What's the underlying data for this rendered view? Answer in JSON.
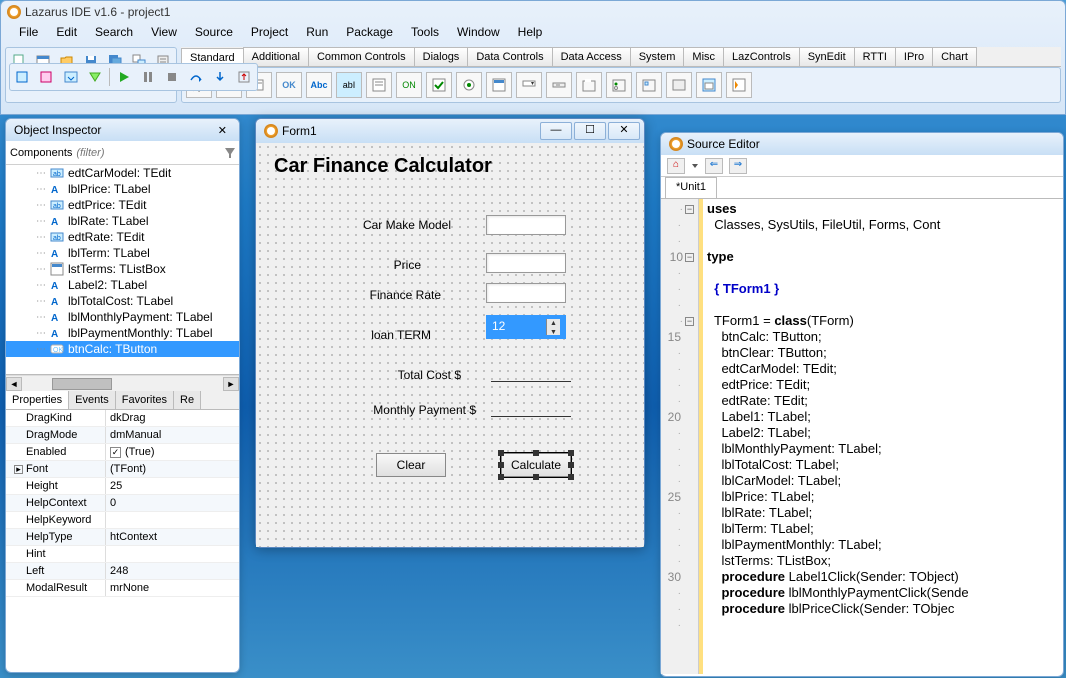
{
  "ide": {
    "title": "Lazarus IDE v1.6 - project1",
    "menu": [
      "File",
      "Edit",
      "Search",
      "View",
      "Source",
      "Project",
      "Run",
      "Package",
      "Tools",
      "Window",
      "Help"
    ],
    "component_tabs": [
      "Standard",
      "Additional",
      "Common Controls",
      "Dialogs",
      "Data Controls",
      "Data Access",
      "System",
      "Misc",
      "LazControls",
      "SynEdit",
      "RTTI",
      "IPro",
      "Chart"
    ],
    "active_comp_tab": "Standard"
  },
  "inspector": {
    "title": "Object Inspector",
    "filter_label": "Components",
    "filter_placeholder": "(filter)",
    "tree": [
      {
        "label": "edtCarModel: TEdit",
        "icon": "edit"
      },
      {
        "label": "lblPrice: TLabel",
        "icon": "label"
      },
      {
        "label": "edtPrice: TEdit",
        "icon": "edit"
      },
      {
        "label": "lblRate: TLabel",
        "icon": "label"
      },
      {
        "label": "edtRate: TEdit",
        "icon": "edit"
      },
      {
        "label": "lblTerm: TLabel",
        "icon": "label"
      },
      {
        "label": "lstTerms: TListBox",
        "icon": "list"
      },
      {
        "label": "Label2: TLabel",
        "icon": "label"
      },
      {
        "label": "lblTotalCost: TLabel",
        "icon": "label"
      },
      {
        "label": "lblMonthlyPayment: TLabel",
        "icon": "label"
      },
      {
        "label": "lblPaymentMonthly: TLabel",
        "icon": "label"
      },
      {
        "label": "btnCalc: TButton",
        "icon": "button",
        "selected": true
      }
    ],
    "prop_tabs": [
      "Properties",
      "Events",
      "Favorites",
      "Re"
    ],
    "active_prop_tab": "Properties",
    "props": [
      {
        "name": "DragKind",
        "value": "dkDrag"
      },
      {
        "name": "DragMode",
        "value": "dmManual"
      },
      {
        "name": "Enabled",
        "value": "(True)",
        "check": true
      },
      {
        "name": "Font",
        "value": "(TFont)",
        "expand": true
      },
      {
        "name": "Height",
        "value": "25"
      },
      {
        "name": "HelpContext",
        "value": "0"
      },
      {
        "name": "HelpKeyword",
        "value": ""
      },
      {
        "name": "HelpType",
        "value": "htContext"
      },
      {
        "name": "Hint",
        "value": ""
      },
      {
        "name": "Left",
        "value": "248"
      },
      {
        "name": "ModalResult",
        "value": "mrNone"
      }
    ]
  },
  "form": {
    "title": "Form1",
    "heading": "Car Finance Calculator",
    "labels": {
      "carmodel": "Car Make Model",
      "price": "Price",
      "rate": "Finance Rate",
      "term": "loan TERM",
      "total": "Total Cost  $",
      "monthly": "Monthly Payment $"
    },
    "lst_value": "12",
    "btn_clear": "Clear",
    "btn_calc": "Calculate"
  },
  "editor": {
    "title": "Source Editor",
    "tab": "*Unit1",
    "gutter": [
      "",
      "",
      "",
      "10",
      "",
      "",
      "",
      "",
      "15",
      "",
      "",
      "",
      "",
      "20",
      "",
      "",
      "",
      "",
      "25",
      "",
      "",
      "",
      "",
      "30",
      "",
      "",
      ""
    ],
    "code_uses_kw": "uses",
    "code_uses_line": "  Classes, SysUtils, FileUtil, Forms, Cont",
    "code_type_kw": "type",
    "code_cmt": "  { TForm1 }",
    "code_class_prefix": "  TForm1 = ",
    "code_class_kw": "class",
    "code_class_suffix": "(TForm)",
    "code_fields": [
      "    btnCalc: TButton;",
      "    btnClear: TButton;",
      "    edtCarModel: TEdit;",
      "    edtPrice: TEdit;",
      "    edtRate: TEdit;",
      "    Label1: TLabel;",
      "    Label2: TLabel;",
      "    lblMonthlyPayment: TLabel;",
      "    lblTotalCost: TLabel;",
      "    lblCarModel: TLabel;",
      "    lblPrice: TLabel;",
      "    lblRate: TLabel;",
      "    lblTerm: TLabel;",
      "    lblPaymentMonthly: TLabel;",
      "    lstTerms: TListBox;"
    ],
    "code_proc_kw": "procedure",
    "code_procs": [
      " Label1Click(Sender: TObject)",
      " lblMonthlyPaymentClick(Sende",
      " lblPriceClick(Sender: TObjec"
    ]
  }
}
